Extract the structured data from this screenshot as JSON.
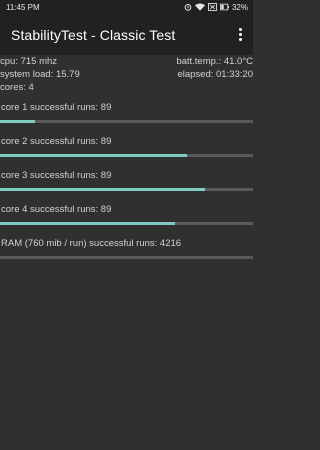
{
  "status_bar": {
    "time": "11:45 PM",
    "battery": "32%",
    "icons": [
      "alarm-icon",
      "wifi-icon",
      "sim-off-icon",
      "battery-icon"
    ]
  },
  "app_bar": {
    "title": "StabilityTest - Classic Test",
    "menu_icon": "more-vert-icon"
  },
  "info": {
    "cpu": "cpu: 715 mhz",
    "batt_temp": "batt.temp.: 41.0°C",
    "system_load": "system load: 15.79",
    "elapsed": "elapsed: 01:33:20",
    "cores": "cores: 4"
  },
  "cores": [
    {
      "label": "core 1 successful runs: 89",
      "progress": 0.14
    },
    {
      "label": "core 2 successful runs: 89",
      "progress": 0.74
    },
    {
      "label": "core 3 successful runs: 89",
      "progress": 0.81
    },
    {
      "label": "core 4 successful runs: 89",
      "progress": 0.69
    }
  ],
  "ram": {
    "label": "RAM (760 mib / run) successful runs: 4216",
    "progress": 0.0
  },
  "colors": {
    "background": "#303030",
    "bar_background": "#212121",
    "progress_fill": "#80cbc4",
    "progress_track": "#5a5a5a"
  }
}
